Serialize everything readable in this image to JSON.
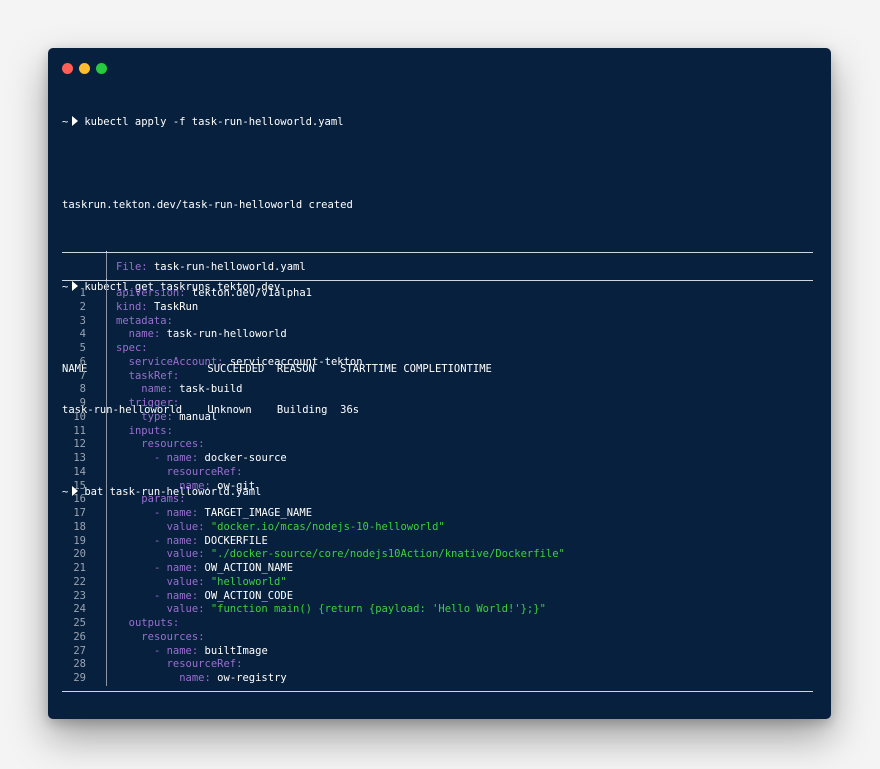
{
  "window": {
    "controls": [
      "close-icon",
      "minimize-icon",
      "maximize-icon"
    ],
    "colors": {
      "background": "#07203d",
      "close": "#ff5f57",
      "minimize": "#febc2e",
      "maximize": "#28c840"
    }
  },
  "terminal": {
    "prompt_symbol": "~",
    "cmd1": "kubectl apply -f task-run-helloworld.yaml",
    "out1": "taskrun.tekton.dev/task-run-helloworld created",
    "cmd2": "kubectl get taskruns.tekton.dev",
    "table_header": "NAME                   SUCCEEDED  REASON    STARTTIME COMPLETIONTIME",
    "table_row": "task-run-helloworld    Unknown    Building  36s",
    "cmd3": "bat task-run-helloworld.yaml"
  },
  "bat": {
    "file_label": "File:",
    "file_name": "task-run-helloworld.yaml",
    "lines": [
      {
        "n": "1",
        "k": "apiVersion",
        "v": "tekton.dev/v1alpha1",
        "indent": "",
        "dash": "",
        "vt": "plain"
      },
      {
        "n": "2",
        "k": "kind",
        "v": "TaskRun",
        "indent": "",
        "dash": "",
        "vt": "plain"
      },
      {
        "n": "3",
        "k": "metadata",
        "v": "",
        "indent": "",
        "dash": "",
        "vt": "plain"
      },
      {
        "n": "4",
        "k": "name",
        "v": "task-run-helloworld",
        "indent": "  ",
        "dash": "",
        "vt": "plain"
      },
      {
        "n": "5",
        "k": "spec",
        "v": "",
        "indent": "",
        "dash": "",
        "vt": "plain"
      },
      {
        "n": "6",
        "k": "serviceAccount",
        "v": "serviceaccount-tekton",
        "indent": "  ",
        "dash": "",
        "vt": "plain"
      },
      {
        "n": "7",
        "k": "taskRef",
        "v": "",
        "indent": "  ",
        "dash": "",
        "vt": "plain"
      },
      {
        "n": "8",
        "k": "name",
        "v": "task-build",
        "indent": "    ",
        "dash": "",
        "vt": "plain"
      },
      {
        "n": "9",
        "k": "trigger",
        "v": "",
        "indent": "  ",
        "dash": "",
        "vt": "plain"
      },
      {
        "n": "10",
        "k": "type",
        "v": "manual",
        "indent": "    ",
        "dash": "",
        "vt": "plain"
      },
      {
        "n": "11",
        "k": "inputs",
        "v": "",
        "indent": "  ",
        "dash": "",
        "vt": "plain"
      },
      {
        "n": "12",
        "k": "resources",
        "v": "",
        "indent": "    ",
        "dash": "",
        "vt": "plain"
      },
      {
        "n": "13",
        "k": "name",
        "v": "docker-source",
        "indent": "      ",
        "dash": "- ",
        "vt": "plain"
      },
      {
        "n": "14",
        "k": "resourceRef",
        "v": "",
        "indent": "        ",
        "dash": "",
        "vt": "plain"
      },
      {
        "n": "15",
        "k": "name",
        "v": "ow-git",
        "indent": "          ",
        "dash": "",
        "vt": "plain"
      },
      {
        "n": "16",
        "k": "params",
        "v": "",
        "indent": "    ",
        "dash": "",
        "vt": "plain"
      },
      {
        "n": "17",
        "k": "name",
        "v": "TARGET_IMAGE_NAME",
        "indent": "      ",
        "dash": "- ",
        "vt": "plain"
      },
      {
        "n": "18",
        "k": "value",
        "v": "\"docker.io/mcas/nodejs-10-helloworld\"",
        "indent": "        ",
        "dash": "",
        "vt": "str"
      },
      {
        "n": "19",
        "k": "name",
        "v": "DOCKERFILE",
        "indent": "      ",
        "dash": "- ",
        "vt": "plain"
      },
      {
        "n": "20",
        "k": "value",
        "v": "\"./docker-source/core/nodejs10Action/knative/Dockerfile\"",
        "indent": "        ",
        "dash": "",
        "vt": "str"
      },
      {
        "n": "21",
        "k": "name",
        "v": "OW_ACTION_NAME",
        "indent": "      ",
        "dash": "- ",
        "vt": "plain"
      },
      {
        "n": "22",
        "k": "value",
        "v": "\"helloworld\"",
        "indent": "        ",
        "dash": "",
        "vt": "str"
      },
      {
        "n": "23",
        "k": "name",
        "v": "OW_ACTION_CODE",
        "indent": "      ",
        "dash": "- ",
        "vt": "plain"
      },
      {
        "n": "24",
        "k": "value",
        "v": "\"function main() {return {payload: 'Hello World!'};}\"",
        "indent": "        ",
        "dash": "",
        "vt": "str"
      },
      {
        "n": "25",
        "k": "outputs",
        "v": "",
        "indent": "  ",
        "dash": "",
        "vt": "plain"
      },
      {
        "n": "26",
        "k": "resources",
        "v": "",
        "indent": "    ",
        "dash": "",
        "vt": "plain"
      },
      {
        "n": "27",
        "k": "name",
        "v": "builtImage",
        "indent": "      ",
        "dash": "- ",
        "vt": "plain"
      },
      {
        "n": "28",
        "k": "resourceRef",
        "v": "",
        "indent": "        ",
        "dash": "",
        "vt": "plain"
      },
      {
        "n": "29",
        "k": "name",
        "v": "ow-registry",
        "indent": "          ",
        "dash": "",
        "vt": "plain"
      }
    ]
  }
}
